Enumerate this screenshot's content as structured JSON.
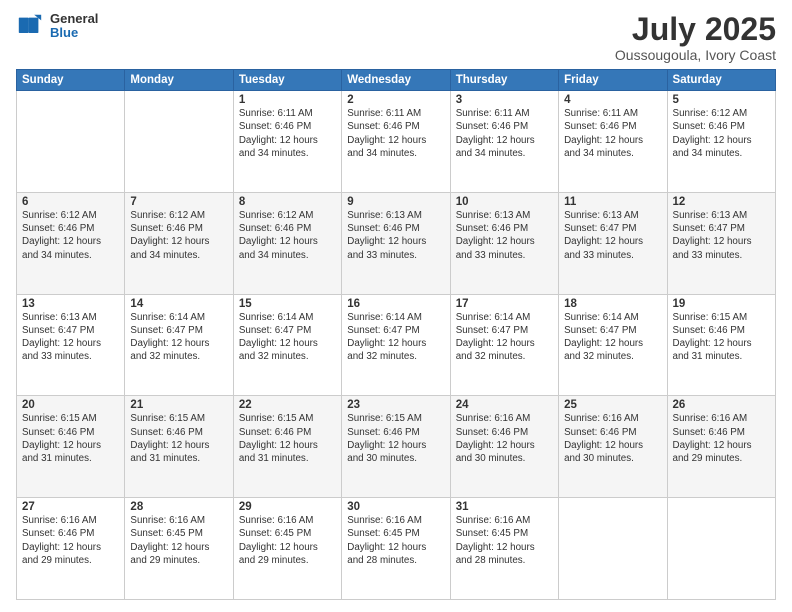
{
  "logo": {
    "general": "General",
    "blue": "Blue"
  },
  "header": {
    "month": "July 2025",
    "location": "Oussougoula, Ivory Coast"
  },
  "weekdays": [
    "Sunday",
    "Monday",
    "Tuesday",
    "Wednesday",
    "Thursday",
    "Friday",
    "Saturday"
  ],
  "weeks": [
    [
      {
        "day": "",
        "info": ""
      },
      {
        "day": "",
        "info": ""
      },
      {
        "day": "1",
        "info": "Sunrise: 6:11 AM\nSunset: 6:46 PM\nDaylight: 12 hours and 34 minutes."
      },
      {
        "day": "2",
        "info": "Sunrise: 6:11 AM\nSunset: 6:46 PM\nDaylight: 12 hours and 34 minutes."
      },
      {
        "day": "3",
        "info": "Sunrise: 6:11 AM\nSunset: 6:46 PM\nDaylight: 12 hours and 34 minutes."
      },
      {
        "day": "4",
        "info": "Sunrise: 6:11 AM\nSunset: 6:46 PM\nDaylight: 12 hours and 34 minutes."
      },
      {
        "day": "5",
        "info": "Sunrise: 6:12 AM\nSunset: 6:46 PM\nDaylight: 12 hours and 34 minutes."
      }
    ],
    [
      {
        "day": "6",
        "info": "Sunrise: 6:12 AM\nSunset: 6:46 PM\nDaylight: 12 hours and 34 minutes."
      },
      {
        "day": "7",
        "info": "Sunrise: 6:12 AM\nSunset: 6:46 PM\nDaylight: 12 hours and 34 minutes."
      },
      {
        "day": "8",
        "info": "Sunrise: 6:12 AM\nSunset: 6:46 PM\nDaylight: 12 hours and 34 minutes."
      },
      {
        "day": "9",
        "info": "Sunrise: 6:13 AM\nSunset: 6:46 PM\nDaylight: 12 hours and 33 minutes."
      },
      {
        "day": "10",
        "info": "Sunrise: 6:13 AM\nSunset: 6:46 PM\nDaylight: 12 hours and 33 minutes."
      },
      {
        "day": "11",
        "info": "Sunrise: 6:13 AM\nSunset: 6:47 PM\nDaylight: 12 hours and 33 minutes."
      },
      {
        "day": "12",
        "info": "Sunrise: 6:13 AM\nSunset: 6:47 PM\nDaylight: 12 hours and 33 minutes."
      }
    ],
    [
      {
        "day": "13",
        "info": "Sunrise: 6:13 AM\nSunset: 6:47 PM\nDaylight: 12 hours and 33 minutes."
      },
      {
        "day": "14",
        "info": "Sunrise: 6:14 AM\nSunset: 6:47 PM\nDaylight: 12 hours and 32 minutes."
      },
      {
        "day": "15",
        "info": "Sunrise: 6:14 AM\nSunset: 6:47 PM\nDaylight: 12 hours and 32 minutes."
      },
      {
        "day": "16",
        "info": "Sunrise: 6:14 AM\nSunset: 6:47 PM\nDaylight: 12 hours and 32 minutes."
      },
      {
        "day": "17",
        "info": "Sunrise: 6:14 AM\nSunset: 6:47 PM\nDaylight: 12 hours and 32 minutes."
      },
      {
        "day": "18",
        "info": "Sunrise: 6:14 AM\nSunset: 6:47 PM\nDaylight: 12 hours and 32 minutes."
      },
      {
        "day": "19",
        "info": "Sunrise: 6:15 AM\nSunset: 6:46 PM\nDaylight: 12 hours and 31 minutes."
      }
    ],
    [
      {
        "day": "20",
        "info": "Sunrise: 6:15 AM\nSunset: 6:46 PM\nDaylight: 12 hours and 31 minutes."
      },
      {
        "day": "21",
        "info": "Sunrise: 6:15 AM\nSunset: 6:46 PM\nDaylight: 12 hours and 31 minutes."
      },
      {
        "day": "22",
        "info": "Sunrise: 6:15 AM\nSunset: 6:46 PM\nDaylight: 12 hours and 31 minutes."
      },
      {
        "day": "23",
        "info": "Sunrise: 6:15 AM\nSunset: 6:46 PM\nDaylight: 12 hours and 30 minutes."
      },
      {
        "day": "24",
        "info": "Sunrise: 6:16 AM\nSunset: 6:46 PM\nDaylight: 12 hours and 30 minutes."
      },
      {
        "day": "25",
        "info": "Sunrise: 6:16 AM\nSunset: 6:46 PM\nDaylight: 12 hours and 30 minutes."
      },
      {
        "day": "26",
        "info": "Sunrise: 6:16 AM\nSunset: 6:46 PM\nDaylight: 12 hours and 29 minutes."
      }
    ],
    [
      {
        "day": "27",
        "info": "Sunrise: 6:16 AM\nSunset: 6:46 PM\nDaylight: 12 hours and 29 minutes."
      },
      {
        "day": "28",
        "info": "Sunrise: 6:16 AM\nSunset: 6:45 PM\nDaylight: 12 hours and 29 minutes."
      },
      {
        "day": "29",
        "info": "Sunrise: 6:16 AM\nSunset: 6:45 PM\nDaylight: 12 hours and 29 minutes."
      },
      {
        "day": "30",
        "info": "Sunrise: 6:16 AM\nSunset: 6:45 PM\nDaylight: 12 hours and 28 minutes."
      },
      {
        "day": "31",
        "info": "Sunrise: 6:16 AM\nSunset: 6:45 PM\nDaylight: 12 hours and 28 minutes."
      },
      {
        "day": "",
        "info": ""
      },
      {
        "day": "",
        "info": ""
      }
    ]
  ]
}
